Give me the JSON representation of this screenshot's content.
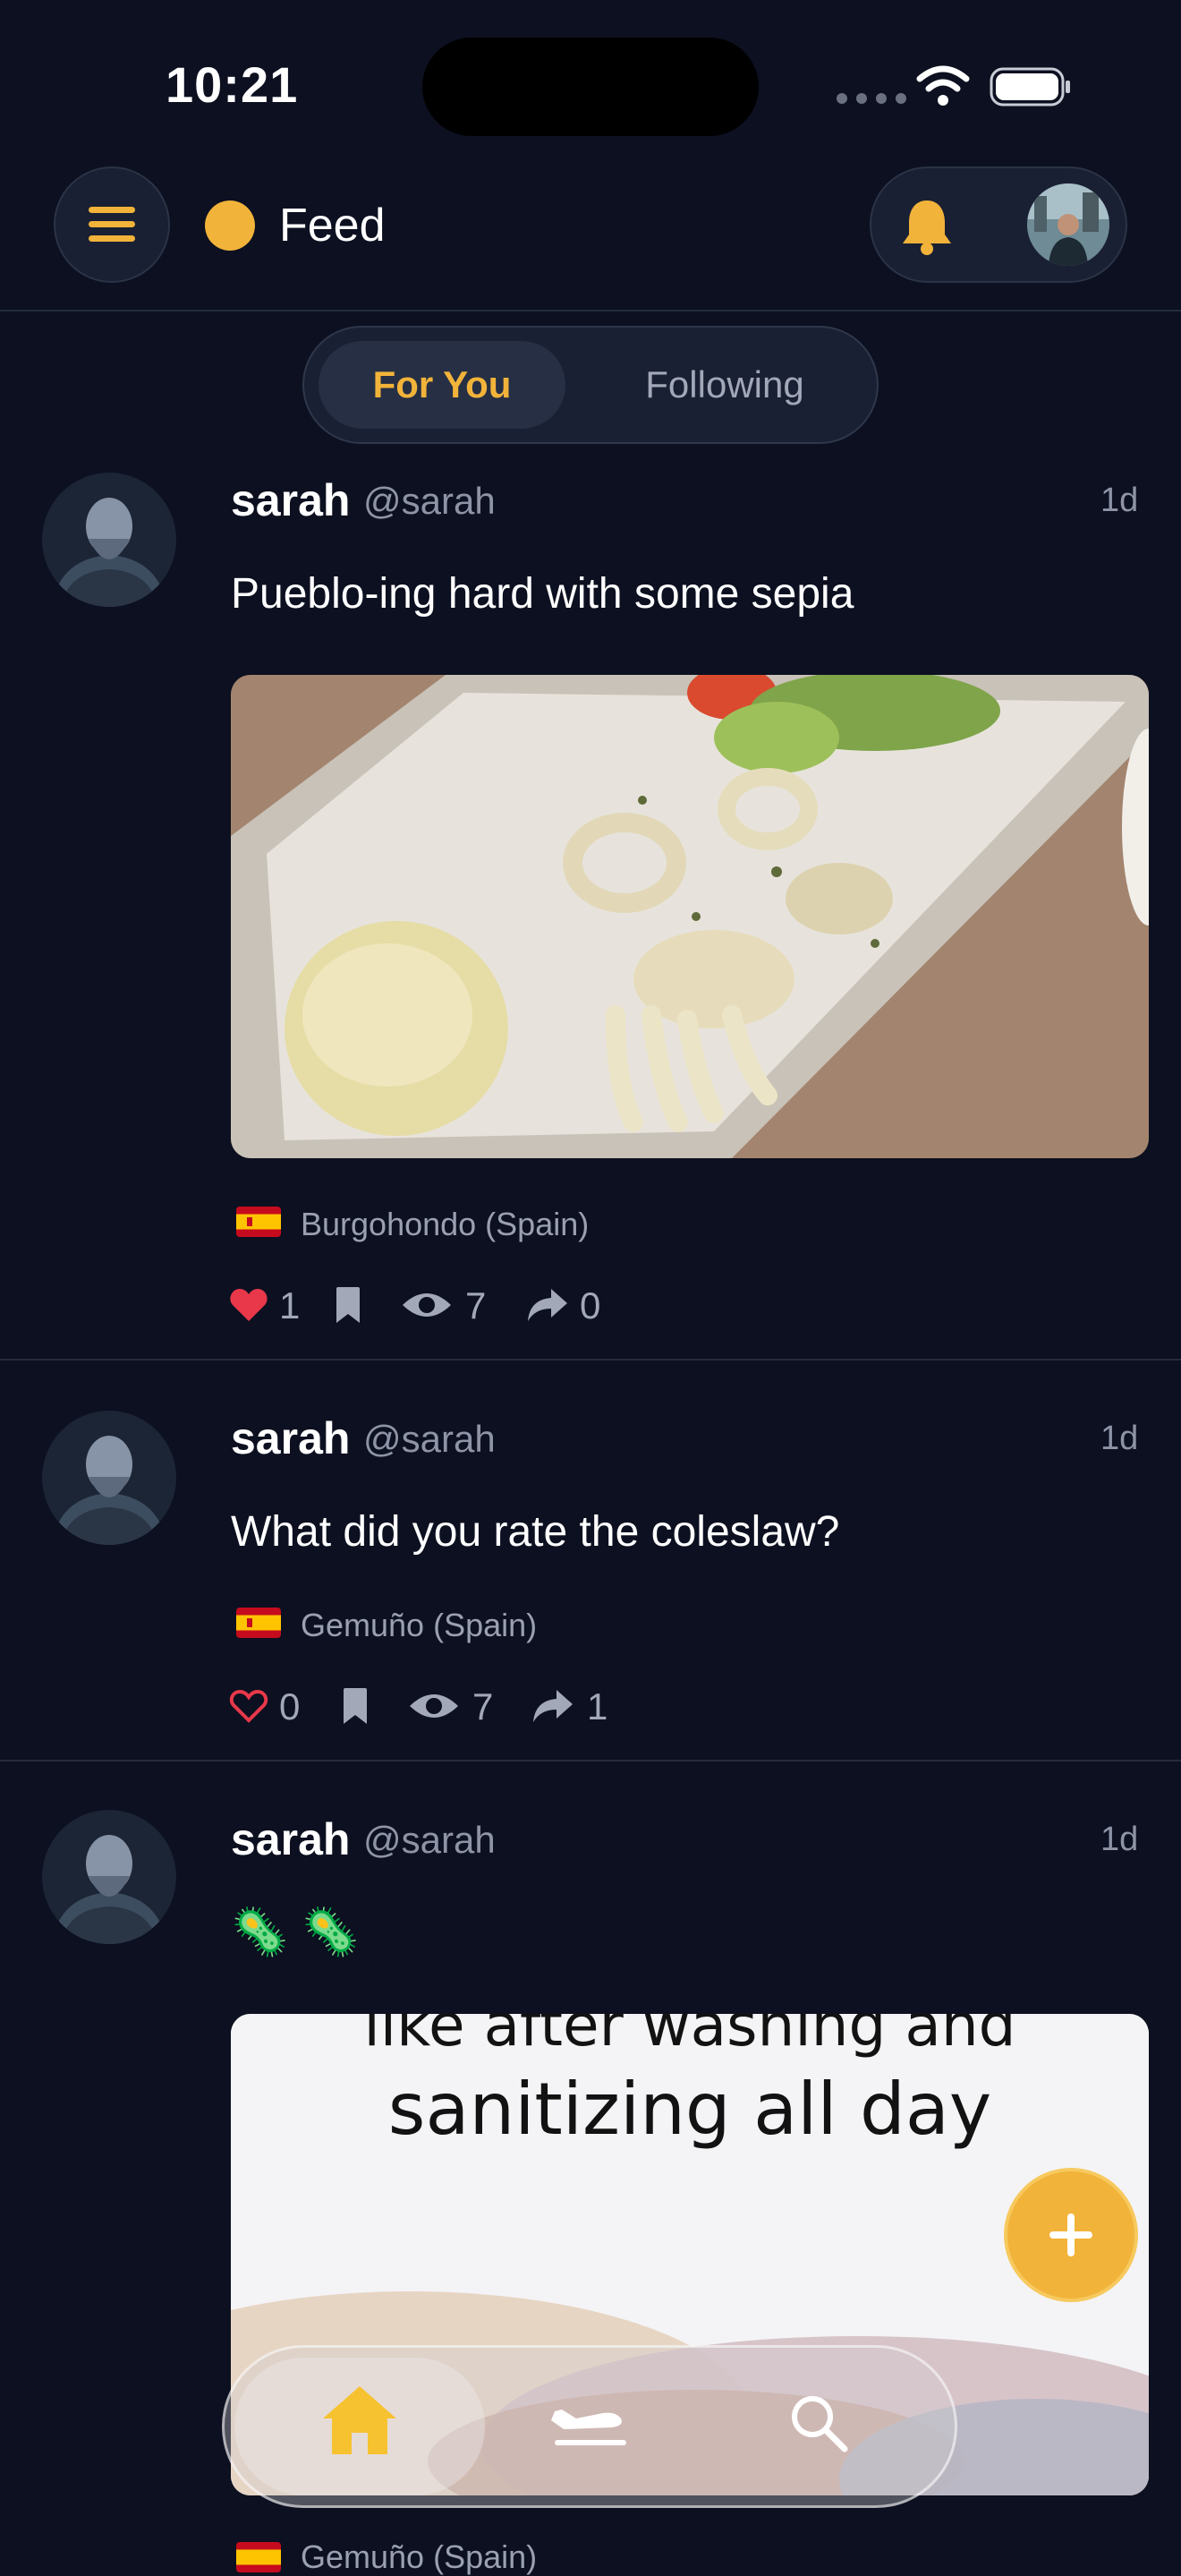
{
  "status_bar": {
    "time": "10:21"
  },
  "header": {
    "title": "Feed",
    "menu_icon": "hamburger-icon",
    "bell_icon": "bell-icon",
    "accent": "#f2b33a"
  },
  "tabs": [
    {
      "label": "For You",
      "active": true
    },
    {
      "label": "Following",
      "active": false
    }
  ],
  "posts": [
    {
      "name": "sarah",
      "handle": "@sarah",
      "ago": "1d",
      "text": "Pueblo-ing hard with some sepia",
      "location": "Burgohondo (Spain)",
      "likes": "1",
      "liked": true,
      "views": "7",
      "shares": "0"
    },
    {
      "name": "sarah",
      "handle": "@sarah",
      "ago": "1d",
      "text": "What did you rate the coleslaw?",
      "location": "Gemuño (Spain)",
      "likes": "0",
      "liked": false,
      "views": "7",
      "shares": "1"
    },
    {
      "name": "sarah",
      "handle": "@sarah",
      "ago": "1d",
      "text": "🦠 🦠",
      "image_text_top": "like after washing and",
      "image_text": "sanitizing all day",
      "location": "Gemuño (Spain)"
    }
  ],
  "bottom_nav": [
    {
      "icon": "home-icon",
      "active": true
    },
    {
      "icon": "plane-landing-icon",
      "active": false
    },
    {
      "icon": "search-icon",
      "active": false
    }
  ],
  "fab": {
    "icon": "plus-icon"
  }
}
